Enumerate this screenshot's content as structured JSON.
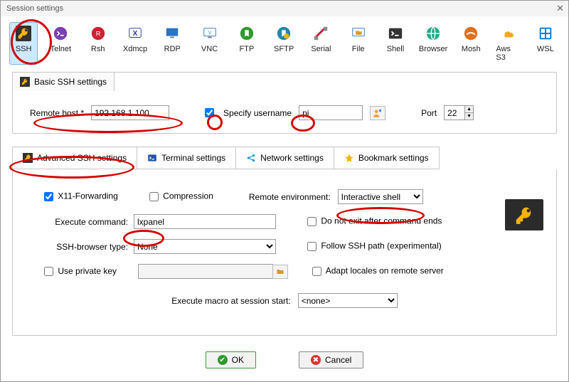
{
  "window": {
    "title": "Session settings"
  },
  "types": [
    {
      "label": "SSH",
      "icon": "key",
      "selected": true
    },
    {
      "label": "Telnet",
      "icon": "telnet",
      "selected": false
    },
    {
      "label": "Rsh",
      "icon": "rsh",
      "selected": false
    },
    {
      "label": "Xdmcp",
      "icon": "xdmcp",
      "selected": false
    },
    {
      "label": "RDP",
      "icon": "rdp",
      "selected": false
    },
    {
      "label": "VNC",
      "icon": "vnc",
      "selected": false
    },
    {
      "label": "FTP",
      "icon": "ftp",
      "selected": false
    },
    {
      "label": "SFTP",
      "icon": "sftp",
      "selected": false
    },
    {
      "label": "Serial",
      "icon": "serial",
      "selected": false
    },
    {
      "label": "File",
      "icon": "file",
      "selected": false
    },
    {
      "label": "Shell",
      "icon": "shell",
      "selected": false
    },
    {
      "label": "Browser",
      "icon": "browser",
      "selected": false
    },
    {
      "label": "Mosh",
      "icon": "mosh",
      "selected": false
    },
    {
      "label": "Aws S3",
      "icon": "aws",
      "selected": false
    },
    {
      "label": "WSL",
      "icon": "wsl",
      "selected": false
    }
  ],
  "basic": {
    "tab_label": "Basic SSH settings",
    "remote_host_label": "Remote host *",
    "remote_host_value": "192.168.1.100",
    "specify_username_label": "Specify username",
    "specify_username_checked": true,
    "username_value": "pi",
    "port_label": "Port",
    "port_value": "22"
  },
  "adv_tabs": {
    "advanced": "Advanced SSH settings",
    "terminal": "Terminal settings",
    "network": "Network settings",
    "bookmark": "Bookmark settings"
  },
  "adv": {
    "x11_label": "X11-Forwarding",
    "x11_checked": true,
    "compression_label": "Compression",
    "compression_checked": false,
    "remote_env_label": "Remote environment:",
    "remote_env_value": "Interactive shell",
    "exec_cmd_label": "Execute command:",
    "exec_cmd_value": "lxpanel",
    "noexit_label": "Do not exit after command ends",
    "noexit_checked": false,
    "browser_type_label": "SSH-browser type:",
    "browser_type_value": "None",
    "follow_path_label": "Follow SSH path (experimental)",
    "follow_path_checked": false,
    "use_pk_label": "Use private key",
    "use_pk_checked": false,
    "pk_path_value": "",
    "adapt_locales_label": "Adapt locales on remote server",
    "adapt_locales_checked": false,
    "macro_label": "Execute macro at session start:",
    "macro_value": "<none>"
  },
  "buttons": {
    "ok": "OK",
    "cancel": "Cancel"
  }
}
